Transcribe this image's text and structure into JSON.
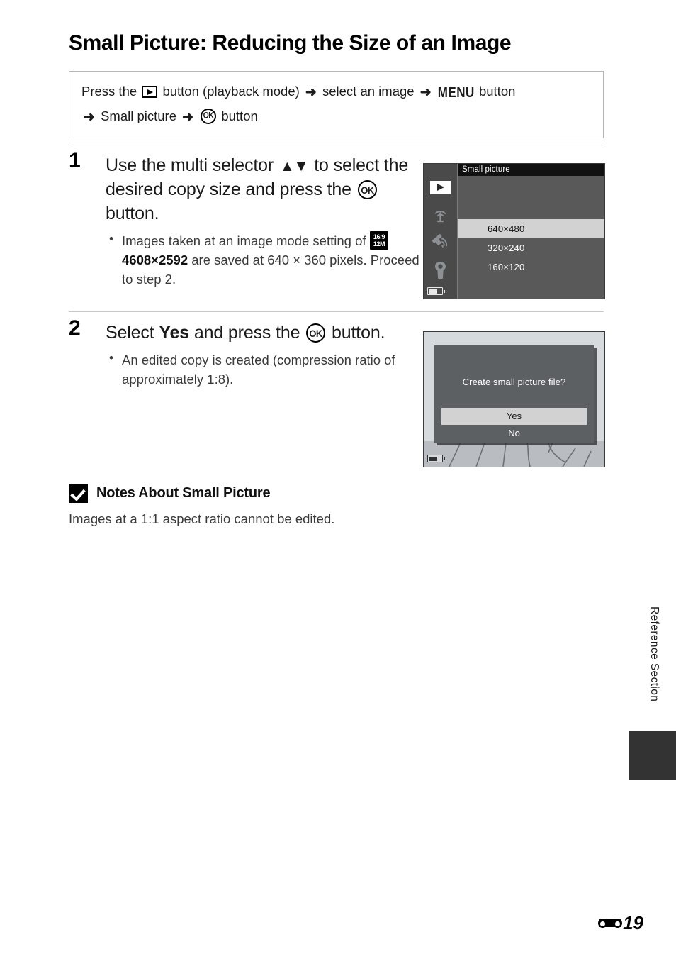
{
  "page": {
    "title": "Small Picture: Reducing the Size of an Image",
    "side_tab_label": "Reference Section",
    "footer_page_number": "19",
    "footer_icon": "reference-section-icon"
  },
  "intro": {
    "line1_part1": "Press the",
    "play_icon": "playback-icon",
    "line1_part2": "button (playback mode)",
    "arrow": "➜",
    "line1_part3": "select an image",
    "menu_label": "MENU",
    "line1_part4": "button",
    "line2_part1": "Small picture",
    "ok_icon": "ok-button-icon",
    "line2_part2": "button"
  },
  "steps": [
    {
      "number": "1",
      "lead_part1": "Use the multi selector",
      "updown_glyphs": "▲▼",
      "lead_part2": "to select the desired copy size and press the",
      "lead_part3": "button.",
      "bullets": [
        {
          "part1": "Images taken at an image mode setting of",
          "mode_icon_top": "16:9",
          "mode_icon_bottom": "12M",
          "bold": "4608×2592",
          "part2": "are saved at 640 × 360 pixels. Proceed to step 2."
        }
      ]
    },
    {
      "number": "2",
      "lead_part1": "Select",
      "lead_bold": "Yes",
      "lead_part2": "and press the",
      "lead_part3": "button.",
      "bullets": [
        {
          "part1": "An edited copy is created (compression ratio of approximately 1:8).",
          "bold": "",
          "part2": ""
        }
      ]
    }
  ],
  "screen_menu": {
    "title": "Small picture",
    "sidebar_icons": [
      "playback-icon",
      "wifi-icon",
      "gps-icon",
      "wrench-setup-icon",
      "battery-icon"
    ],
    "items": [
      {
        "label": "640×480",
        "selected": true
      },
      {
        "label": "320×240",
        "selected": false
      },
      {
        "label": "160×120",
        "selected": false
      }
    ]
  },
  "screen_confirm": {
    "message": "Create small picture file?",
    "options": [
      {
        "label": "Yes",
        "selected": true
      },
      {
        "label": "No",
        "selected": false
      }
    ],
    "battery_icon": "battery-icon"
  },
  "notes": {
    "icon": "caution-check-icon",
    "title": "Notes About Small Picture",
    "text": "Images at a 1:1 aspect ratio cannot be edited."
  },
  "colors": {
    "screen_bg": "#595959",
    "screen_sidebar": "#4a4a4a",
    "screen_title_bar": "#111111",
    "selected_row": "#d2d2d2",
    "dialog_bg": "#5d6063",
    "confirm_screen_bg": "#d7dadd",
    "rule": "#c9c9c9",
    "box_border": "#b5b5b5"
  }
}
